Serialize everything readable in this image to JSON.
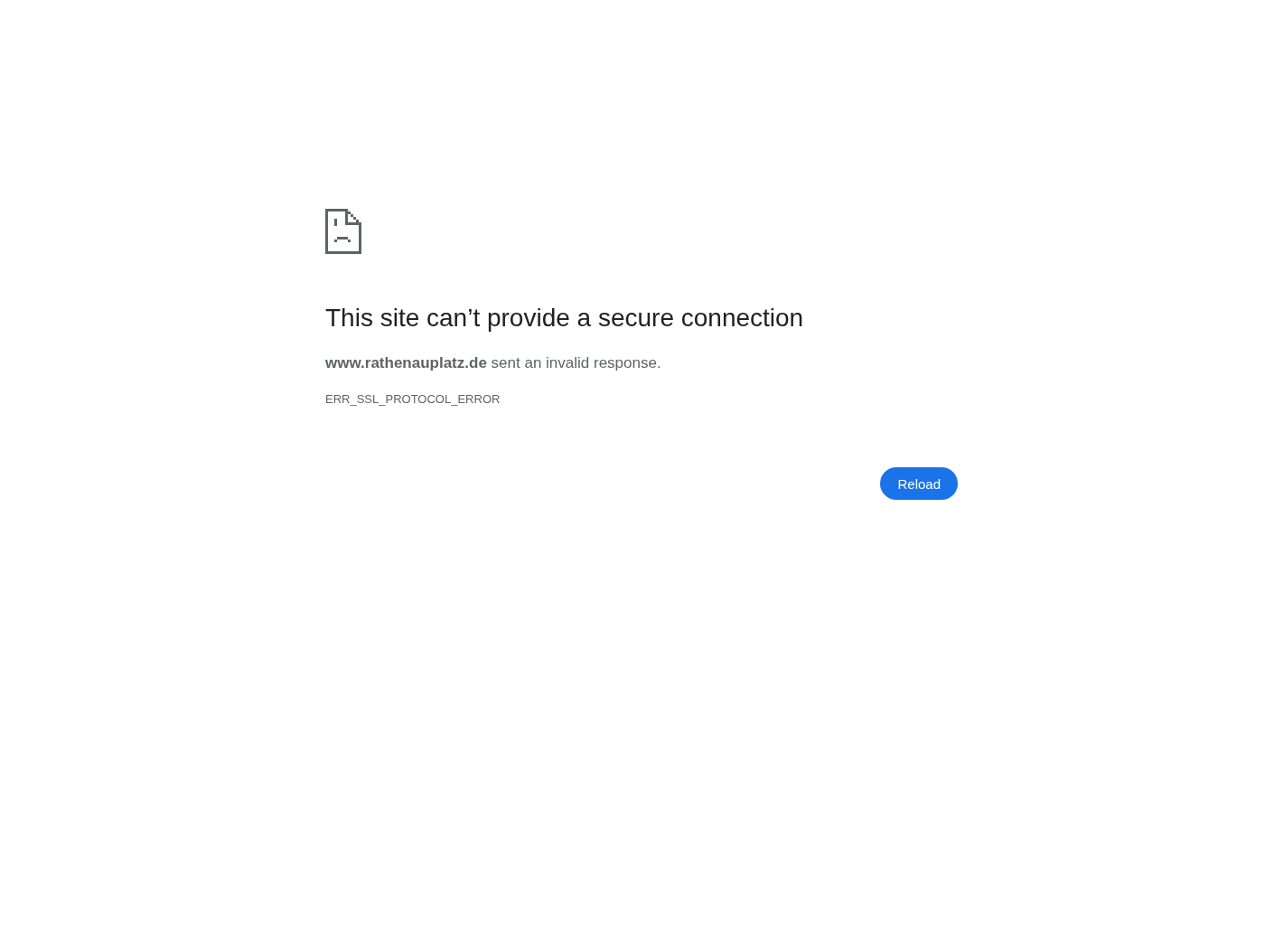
{
  "error_page": {
    "title": "This site can’t provide a secure connection",
    "message": "**www.rathenauplatz.de** sent an invalid response.",
    "error_code": "ERR_SSL_PROTOCOL_ERROR",
    "buttons": [
      {
        "label": "Reload",
        "kind": "primary"
      }
    ]
  }
}
